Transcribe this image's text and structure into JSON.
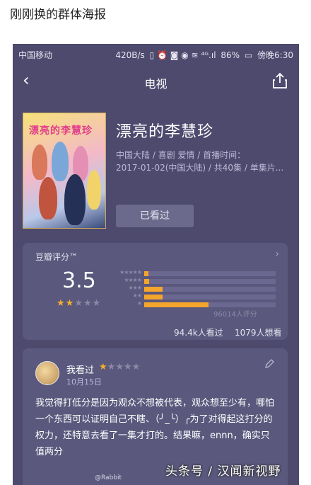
{
  "post": {
    "caption": "刚刚换的群体海报"
  },
  "status_bar": {
    "carrier": "中国移动",
    "speed": "420B/s",
    "indicators": "▯ ⏰ ◙ ◉ ≋ ⁴ᴳ.ıl",
    "battery": "86%",
    "time": "傍晚6:30"
  },
  "nav": {
    "back_icon": "‹",
    "title": "电视",
    "share_icon": "share-icon"
  },
  "show": {
    "poster_title": "漂亮的李慧珍",
    "title": "漂亮的李慧珍",
    "meta_line1": "中国大陆 / 喜剧 爱情 / 首播时间：",
    "meta_line2": "2017-01-02(中国大陆) / 共40集 / 单集片...",
    "watched_button": "已看过"
  },
  "rating": {
    "label": "豆瓣评分™",
    "score": "3.5",
    "stars_filled": 2,
    "stars_total": 5,
    "distribution": [
      {
        "stars": "★★★★★",
        "fraction": 0.03
      },
      {
        "stars": "★★★★",
        "fraction": 0.04
      },
      {
        "stars": "★★★",
        "fraction": 0.14
      },
      {
        "stars": "★★",
        "fraction": 0.14
      },
      {
        "stars": "★",
        "fraction": 0.49
      }
    ],
    "rating_count": "96014人评分",
    "watched_count": "94.4k人看过",
    "want_count": "1079人想看"
  },
  "review": {
    "user_label": "我看过",
    "stars_filled": 1,
    "stars_total": 5,
    "date": "10月15日",
    "text": "我觉得打低分是因为观众不想被代表，观众想至少有，哪怕一个东西可以证明自己不瞎、（╯_╰）╭为了对得起这打分的权力，还特意去看了一集才打的。结果嘛，ennn，确实只值两分"
  },
  "watermark": {
    "main": "头条号 / 汉闻新视野",
    "bottom": "@Rabbit"
  },
  "colors": {
    "background": "#4d4a6e",
    "card": "#5a587c",
    "accent_star": "#f3b02c"
  }
}
